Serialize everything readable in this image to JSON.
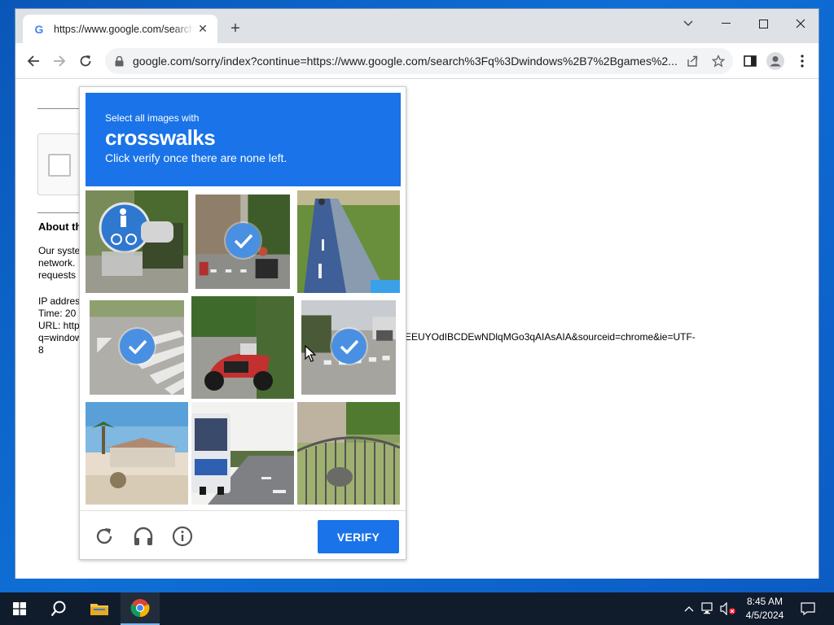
{
  "browser": {
    "tab_title": "https://www.google.com/search?q",
    "tab_favicon": "G",
    "url": "google.com/sorry/index?continue=https://www.google.com/search%3Fq%3Dwindows%2B7%2Bgames%2..."
  },
  "page": {
    "about_heading": "About th",
    "paragraph_lines": [
      "Our syste",
      "network.",
      "requests"
    ],
    "ip_lines": [
      "IP addres",
      "Time: 20",
      "URL: http",
      "q=window",
      "8"
    ],
    "url_tail": "EEUYOdIBCDEwNDlqMGo3qAIAsAIA&sourceid=chrome&ie=UTF-"
  },
  "captcha": {
    "instruction_pre": "Select all images with",
    "keyword": "crosswalks",
    "instruction_post": "Click verify once there are none left.",
    "verify_label": "VERIFY",
    "selected_tiles": [
      1,
      3,
      5
    ],
    "footer_icons": [
      "reload-icon",
      "audio-headphones-icon",
      "info-icon"
    ]
  },
  "taskbar": {
    "time": "8:45 AM",
    "date": "4/5/2024"
  },
  "colors": {
    "captcha_blue": "#1a73e8",
    "check_blue": "#4a90e2",
    "taskbar_bg": "#101c2c"
  }
}
